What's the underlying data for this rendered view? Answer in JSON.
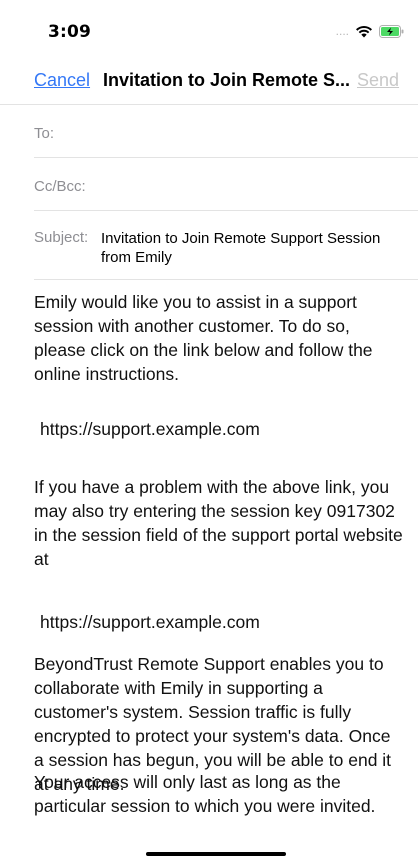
{
  "status_bar": {
    "time": "3:09",
    "signal": "....",
    "icons": [
      "wifi-icon",
      "battery-charging-icon"
    ],
    "battery_color": "#4cd964"
  },
  "nav": {
    "cancel_label": "Cancel",
    "title": "Invitation to Join Remote S...",
    "send_label": "Send",
    "accent_color": "#3478f6"
  },
  "fields": {
    "to_label": "To:",
    "cc_label": "Cc/Bcc:",
    "subject_label": "Subject:",
    "subject_value": "Invitation to Join Remote Support Session from Emily"
  },
  "body": {
    "p1": "Emily would like you to assist in a support session with another customer. To do so, please click on the link below and follow the online instructions.",
    "link1": "https://support.example.com",
    "p2": "If you have a problem with the above link, you may also try entering the session key 0917302 in the session field of the support portal website at",
    "link2": "https://support.example.com",
    "p3": "BeyondTrust Remote Support enables you to collaborate with Emily in supporting a customer's system. Session traffic is fully encrypted to protect your system's data. Once a session has begun, you will be able to end it at any time.",
    "p4": "Your access will only last as long as the particular session to which you were invited."
  }
}
